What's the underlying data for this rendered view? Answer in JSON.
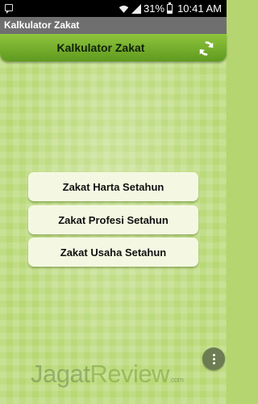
{
  "status_bar": {
    "battery_percent": "31%",
    "time": "10:41 AM"
  },
  "app_titlebar": {
    "title": "Kalkulator Zakat"
  },
  "header": {
    "title": "Kalkulator Zakat",
    "refresh_icon": "refresh-icon"
  },
  "menu": {
    "items": [
      {
        "label": "Zakat Harta Setahun"
      },
      {
        "label": "Zakat Profesi Setahun"
      },
      {
        "label": "Zakat Usaha Setahun"
      }
    ]
  },
  "overflow_icon": "more-vert-icon",
  "watermark": {
    "brand_a": "Jagat",
    "brand_b": "Review",
    "suffix": ".com"
  },
  "colors": {
    "header_green": "#6fab2a",
    "background_green": "#b7d874",
    "button_bg": "#f4f8e2"
  }
}
